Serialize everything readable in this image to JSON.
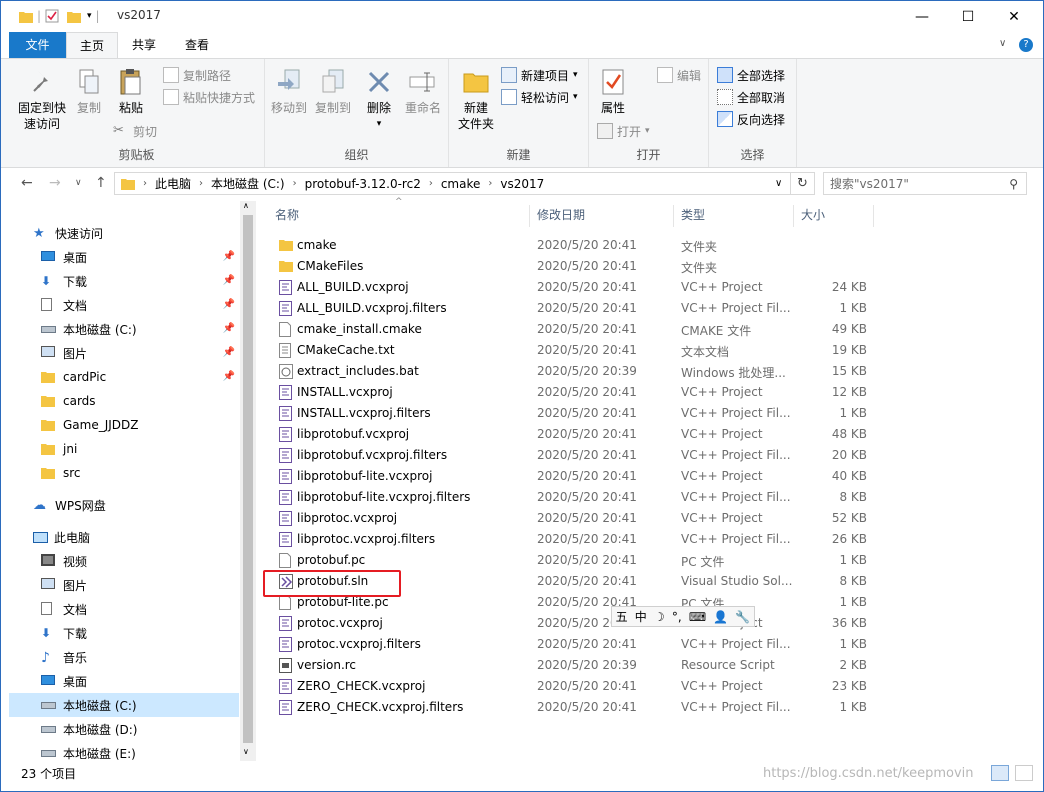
{
  "window": {
    "title": "vs2017",
    "controls": {
      "minimize": "—",
      "maximize": "☐",
      "close": "✕"
    }
  },
  "menu": {
    "file": "文件",
    "home": "主页",
    "share": "共享",
    "view": "查看",
    "help_icon": "?"
  },
  "ribbon": {
    "clipboard": {
      "label": "剪贴板",
      "pin": "固定到快\n速访问",
      "copy": "复制",
      "paste": "粘贴",
      "copy_path": "复制路径",
      "paste_shortcut": "粘贴快捷方式",
      "cut": "剪切"
    },
    "organize": {
      "label": "组织",
      "move_to": "移动到",
      "copy_to": "复制到",
      "delete": "删除",
      "rename": "重命名"
    },
    "new": {
      "label": "新建",
      "new_folder": "新建\n文件夹",
      "new_item": "新建项目",
      "easy_access": "轻松访问"
    },
    "open": {
      "label": "打开",
      "properties": "属性",
      "open": "打开",
      "edit": "编辑"
    },
    "select": {
      "label": "选择",
      "select_all": "全部选择",
      "select_none": "全部取消",
      "invert": "反向选择"
    }
  },
  "address": {
    "crumbs": [
      "此电脑",
      "本地磁盘 (C:)",
      "protobuf-3.12.0-rc2",
      "cmake",
      "vs2017"
    ],
    "search_placeholder": "搜索\"vs2017\""
  },
  "nav": {
    "quick_access": "快速访问",
    "quick_items": [
      {
        "label": "桌面",
        "icon": "desktop-icon",
        "pinned": true
      },
      {
        "label": "下载",
        "icon": "download-icon",
        "pinned": true
      },
      {
        "label": "文档",
        "icon": "documents-icon",
        "pinned": true
      },
      {
        "label": "本地磁盘 (C:)",
        "icon": "drive-icon",
        "pinned": true
      },
      {
        "label": "图片",
        "icon": "pictures-icon",
        "pinned": true
      },
      {
        "label": "cardPic",
        "icon": "folder-icon",
        "pinned": true
      },
      {
        "label": "cards",
        "icon": "folder-icon",
        "pinned": false
      },
      {
        "label": "Game_JJDDZ",
        "icon": "folder-icon",
        "pinned": false
      },
      {
        "label": "jni",
        "icon": "folder-icon",
        "pinned": false
      },
      {
        "label": "src",
        "icon": "folder-icon",
        "pinned": false
      }
    ],
    "wps": "WPS网盘",
    "this_pc": "此电脑",
    "pc_items": [
      {
        "label": "视频",
        "icon": "videos-icon"
      },
      {
        "label": "图片",
        "icon": "pictures-icon"
      },
      {
        "label": "文档",
        "icon": "documents-icon"
      },
      {
        "label": "下载",
        "icon": "download-icon"
      },
      {
        "label": "音乐",
        "icon": "music-icon"
      },
      {
        "label": "桌面",
        "icon": "desktop-icon"
      },
      {
        "label": "本地磁盘 (C:)",
        "icon": "drive-icon",
        "selected": true
      },
      {
        "label": "本地磁盘 (D:)",
        "icon": "drive-icon"
      },
      {
        "label": "本地磁盘 (E:)",
        "icon": "drive-icon"
      }
    ]
  },
  "columns": {
    "name": "名称",
    "date": "修改日期",
    "type": "类型",
    "size": "大小"
  },
  "files": [
    {
      "name": "cmake",
      "date": "2020/5/20 20:41",
      "type": "文件夹",
      "size": "",
      "kind": "folder"
    },
    {
      "name": "CMakeFiles",
      "date": "2020/5/20 20:41",
      "type": "文件夹",
      "size": "",
      "kind": "folder"
    },
    {
      "name": "ALL_BUILD.vcxproj",
      "date": "2020/5/20 20:41",
      "type": "VC++ Project",
      "size": "24 KB",
      "kind": "vc"
    },
    {
      "name": "ALL_BUILD.vcxproj.filters",
      "date": "2020/5/20 20:41",
      "type": "VC++ Project Fil...",
      "size": "1 KB",
      "kind": "vc"
    },
    {
      "name": "cmake_install.cmake",
      "date": "2020/5/20 20:41",
      "type": "CMAKE 文件",
      "size": "49 KB",
      "kind": "doc"
    },
    {
      "name": "CMakeCache.txt",
      "date": "2020/5/20 20:41",
      "type": "文本文档",
      "size": "19 KB",
      "kind": "txt"
    },
    {
      "name": "extract_includes.bat",
      "date": "2020/5/20 20:39",
      "type": "Windows 批处理...",
      "size": "15 KB",
      "kind": "bat"
    },
    {
      "name": "INSTALL.vcxproj",
      "date": "2020/5/20 20:41",
      "type": "VC++ Project",
      "size": "12 KB",
      "kind": "vc"
    },
    {
      "name": "INSTALL.vcxproj.filters",
      "date": "2020/5/20 20:41",
      "type": "VC++ Project Fil...",
      "size": "1 KB",
      "kind": "vc"
    },
    {
      "name": "libprotobuf.vcxproj",
      "date": "2020/5/20 20:41",
      "type": "VC++ Project",
      "size": "48 KB",
      "kind": "vc"
    },
    {
      "name": "libprotobuf.vcxproj.filters",
      "date": "2020/5/20 20:41",
      "type": "VC++ Project Fil...",
      "size": "20 KB",
      "kind": "vc"
    },
    {
      "name": "libprotobuf-lite.vcxproj",
      "date": "2020/5/20 20:41",
      "type": "VC++ Project",
      "size": "40 KB",
      "kind": "vc"
    },
    {
      "name": "libprotobuf-lite.vcxproj.filters",
      "date": "2020/5/20 20:41",
      "type": "VC++ Project Fil...",
      "size": "8 KB",
      "kind": "vc"
    },
    {
      "name": "libprotoc.vcxproj",
      "date": "2020/5/20 20:41",
      "type": "VC++ Project",
      "size": "52 KB",
      "kind": "vc"
    },
    {
      "name": "libprotoc.vcxproj.filters",
      "date": "2020/5/20 20:41",
      "type": "VC++ Project Fil...",
      "size": "26 KB",
      "kind": "vc"
    },
    {
      "name": "protobuf.pc",
      "date": "2020/5/20 20:41",
      "type": "PC 文件",
      "size": "1 KB",
      "kind": "doc"
    },
    {
      "name": "protobuf.sln",
      "date": "2020/5/20 20:41",
      "type": "Visual Studio Sol...",
      "size": "8 KB",
      "kind": "sln"
    },
    {
      "name": "protobuf-lite.pc",
      "date": "2020/5/20 20:41",
      "type": "PC 文件",
      "size": "1 KB",
      "kind": "doc"
    },
    {
      "name": "protoc.vcxproj",
      "date": "2020/5/20 20:41",
      "type": "VC++ Project",
      "size": "36 KB",
      "kind": "vc"
    },
    {
      "name": "protoc.vcxproj.filters",
      "date": "2020/5/20 20:41",
      "type": "VC++ Project Fil...",
      "size": "1 KB",
      "kind": "vc"
    },
    {
      "name": "version.rc",
      "date": "2020/5/20 20:39",
      "type": "Resource Script",
      "size": "2 KB",
      "kind": "rc"
    },
    {
      "name": "ZERO_CHECK.vcxproj",
      "date": "2020/5/20 20:41",
      "type": "VC++ Project",
      "size": "23 KB",
      "kind": "vc"
    },
    {
      "name": "ZERO_CHECK.vcxproj.filters",
      "date": "2020/5/20 20:41",
      "type": "VC++ Project Fil...",
      "size": "1 KB",
      "kind": "vc"
    }
  ],
  "status": {
    "count": "23 个项目"
  },
  "ime": {
    "items": [
      "五",
      "中",
      "☽",
      "°,",
      "⌨",
      "👤",
      "🔧"
    ]
  },
  "watermark": "https://blog.csdn.net/keepmovin",
  "colors": {
    "accent": "#1979ca",
    "selection": "#cce8ff",
    "highlight_box": "#e51c23"
  }
}
